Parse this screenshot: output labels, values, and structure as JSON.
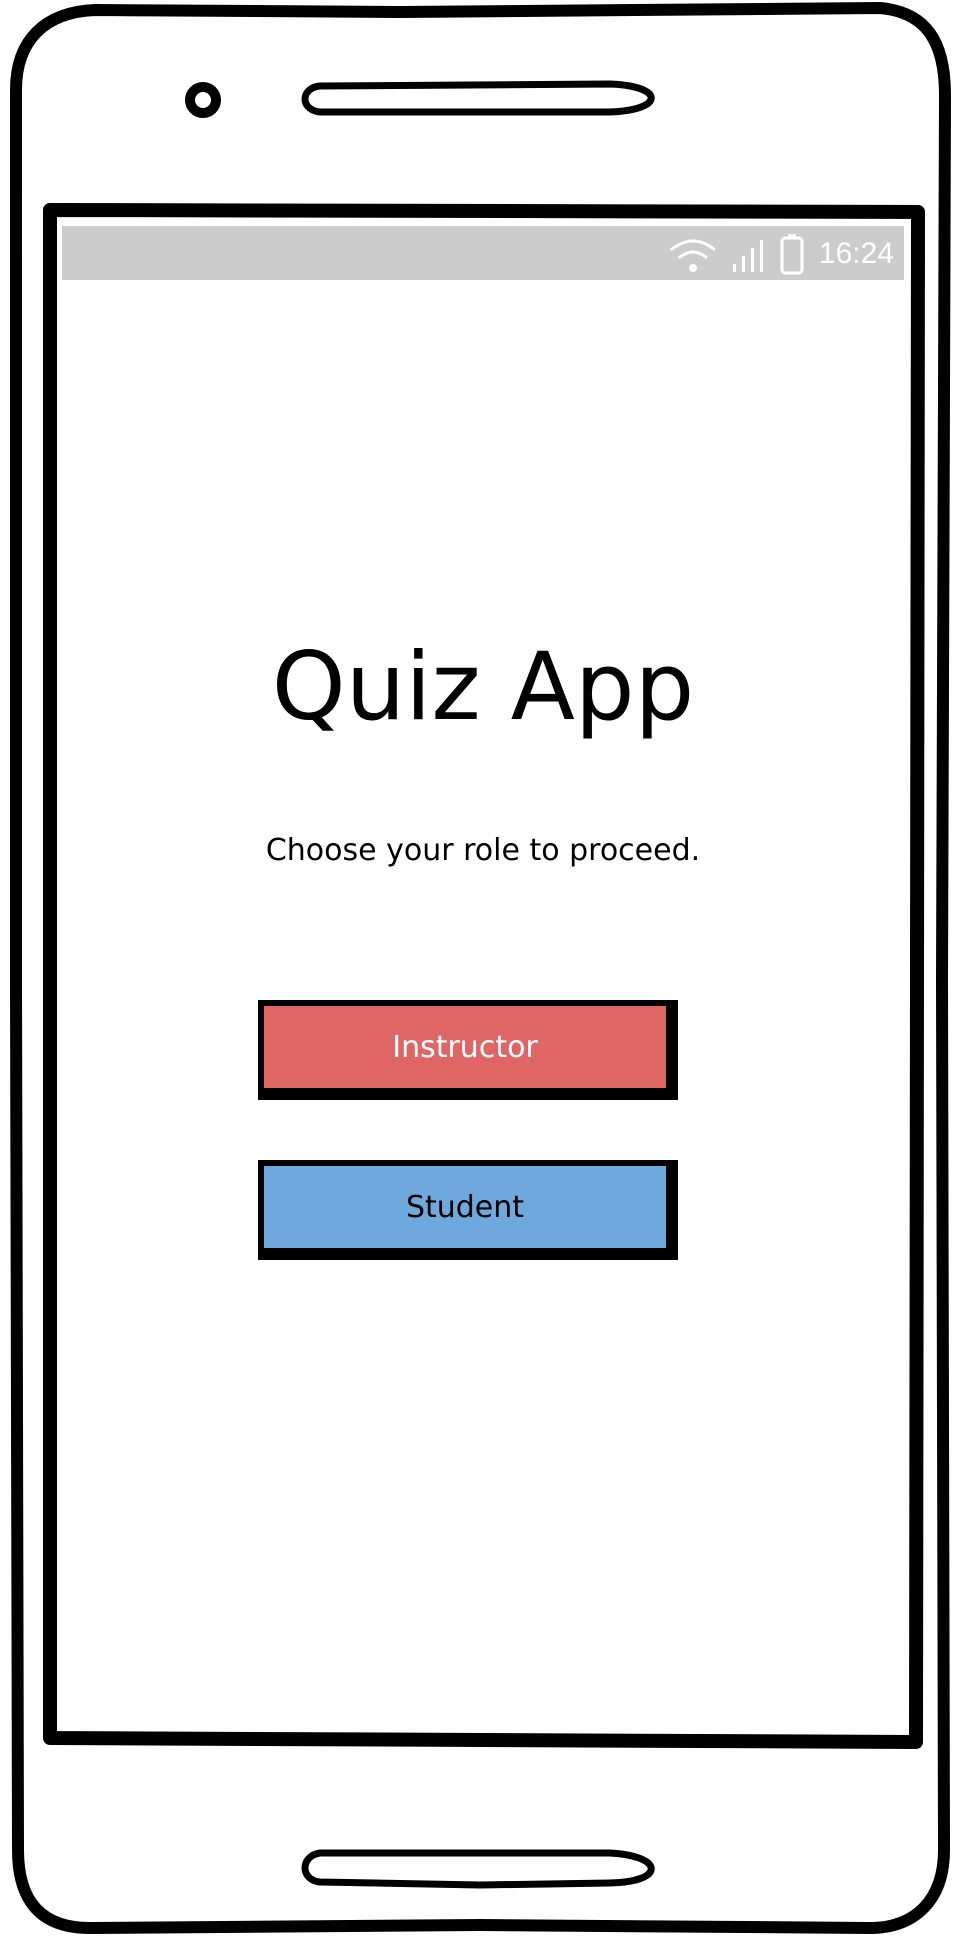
{
  "status_bar": {
    "time": "16:24",
    "wifi_icon": "wifi-icon",
    "signal_icon": "signal-icon",
    "battery_icon": "battery-icon",
    "background_color": "#cccccc"
  },
  "main": {
    "title": "Quiz App",
    "subtitle": "Choose your role to proceed."
  },
  "buttons": {
    "instructor": {
      "label": "Instructor",
      "color": "#e06666"
    },
    "student": {
      "label": "Student",
      "color": "#6fa8dc"
    }
  },
  "device": {
    "camera_icon": "camera-icon",
    "speaker_icon": "speaker-grille-icon",
    "home_bar_icon": "home-bar-icon"
  }
}
